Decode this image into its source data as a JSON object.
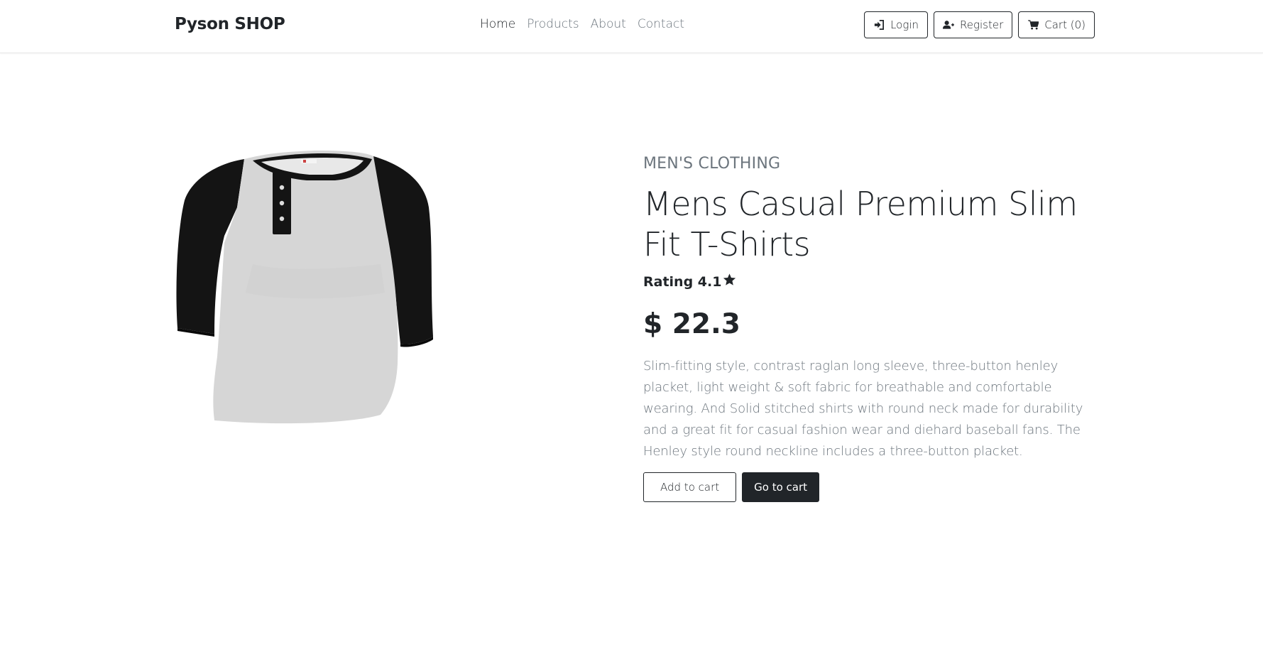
{
  "navbar": {
    "brand": "Pyson SHOP",
    "links": [
      {
        "label": "Home",
        "active": true
      },
      {
        "label": "Products",
        "active": false
      },
      {
        "label": "About",
        "active": false
      },
      {
        "label": "Contact",
        "active": false
      }
    ],
    "actions": {
      "login": {
        "label": "Login",
        "icon": "sign-in-icon"
      },
      "register": {
        "label": "Register",
        "icon": "user-plus-icon"
      },
      "cart": {
        "label": "Cart (0)",
        "icon": "cart-icon"
      }
    }
  },
  "product": {
    "category": "men's clothing",
    "title": "Mens Casual Premium Slim Fit T-Shirts",
    "rating_text": "Rating 4.1",
    "rating_icon": "star-icon",
    "price": "$ 22.3",
    "description": "Slim-fitting style, contrast raglan long sleeve, three-button henley placket, light weight & soft fabric for breathable and comfortable wearing. And Solid stitched shirts with round neck made for durability and a great fit for casual fashion wear and diehard baseball fans. The Henley style round neckline includes a three-button placket.",
    "image_icon": "raglan-henley-shirt-image",
    "add_to_cart": "Add to cart",
    "go_to_cart": "Go to cart"
  },
  "colors": {
    "text_dark": "#212529",
    "text_muted": "#6c757d",
    "shirt_body": "#d9d9d9",
    "shirt_sleeve": "#1a1a1a"
  }
}
